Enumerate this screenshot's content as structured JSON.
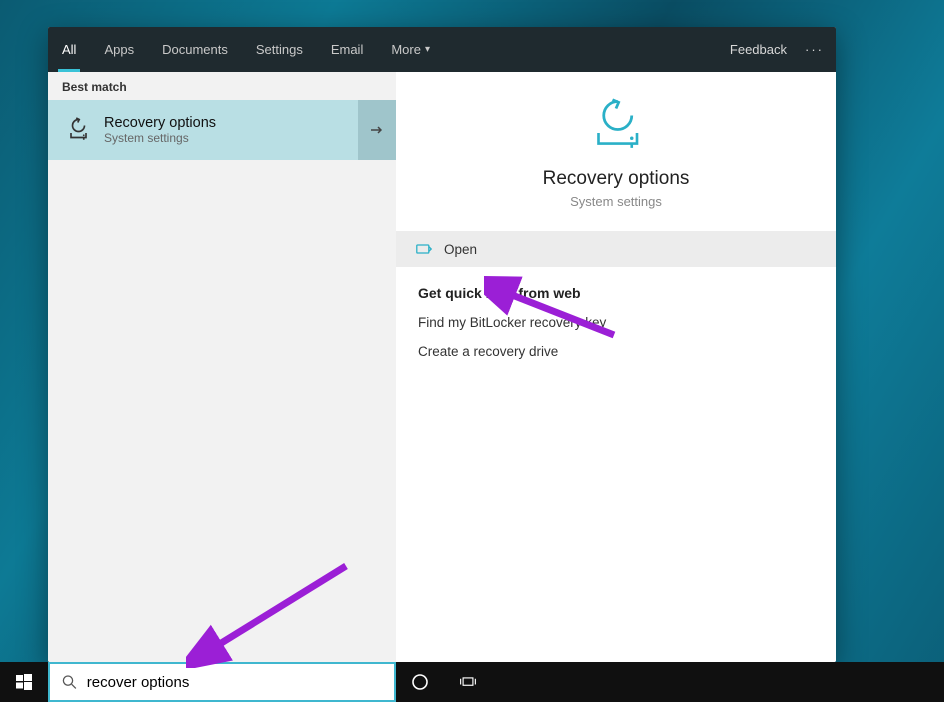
{
  "tabs": {
    "all": "All",
    "apps": "Apps",
    "documents": "Documents",
    "settings": "Settings",
    "email": "Email",
    "more": "More",
    "feedback": "Feedback"
  },
  "left": {
    "best_match_label": "Best match",
    "result_title": "Recovery options",
    "result_sub": "System settings"
  },
  "right": {
    "title": "Recovery options",
    "sub": "System settings",
    "open_label": "Open",
    "quick_help_header": "Get quick help from web",
    "links": [
      "Find my BitLocker recovery key",
      "Create a recovery drive"
    ]
  },
  "search": {
    "value": "recover options"
  }
}
